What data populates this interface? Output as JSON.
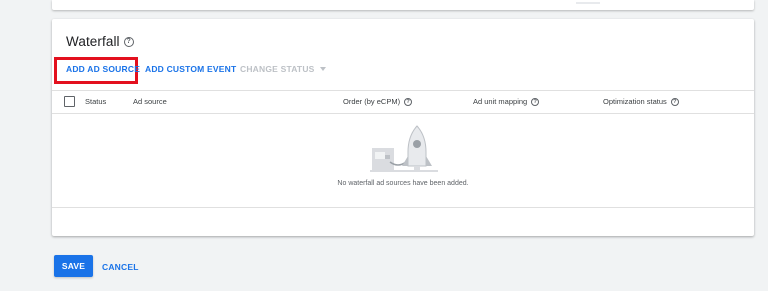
{
  "waterfall": {
    "title": "Waterfall",
    "help_icon": "help-circle-icon",
    "actions": {
      "add_ad_source": "ADD AD SOURCE",
      "add_custom_event": "ADD CUSTOM EVENT",
      "change_status": "CHANGE STATUS"
    },
    "columns": {
      "status": "Status",
      "ad_source": "Ad source",
      "order": "Order (by eCPM)",
      "ad_unit_mapping": "Ad unit mapping",
      "optimization_status": "Optimization status"
    },
    "empty_message": "No waterfall ad sources have been added."
  },
  "footer": {
    "save": "SAVE",
    "cancel": "CANCEL"
  },
  "colors": {
    "accent": "#1a73e8",
    "highlight": "#e3101e",
    "disabled": "#bdc1c6"
  }
}
